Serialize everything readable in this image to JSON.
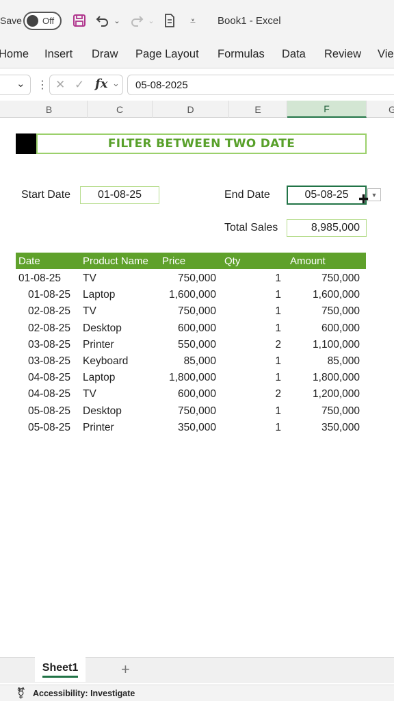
{
  "titlebar": {
    "autosave_label": "Save",
    "toggle_label": "Off",
    "book_title": "Book1  -  Excel"
  },
  "ribbon_tabs": [
    "Home",
    "Insert",
    "Draw",
    "Page Layout",
    "Formulas",
    "Data",
    "Review",
    "Vie"
  ],
  "formula_bar": {
    "fx_label": "fx",
    "value": "05-08-2025"
  },
  "columns": [
    "B",
    "C",
    "D",
    "E",
    "F",
    "G"
  ],
  "banner": {
    "title": "FILTER BETWEEN TWO DATE"
  },
  "filters": {
    "start_label": "Start Date",
    "start_value": "01-08-25",
    "end_label": "End Date",
    "end_value": "05-08-25",
    "total_label": "Total Sales",
    "total_value": "8,985,000"
  },
  "table": {
    "headers": [
      "Date",
      "Product Name",
      "Price",
      "Qty",
      "Amount"
    ],
    "rows": [
      [
        "01-08-25",
        "TV",
        "750,000",
        "1",
        "750,000"
      ],
      [
        "01-08-25",
        "Laptop",
        "1,600,000",
        "1",
        "1,600,000"
      ],
      [
        "02-08-25",
        "TV",
        "750,000",
        "1",
        "750,000"
      ],
      [
        "02-08-25",
        "Desktop",
        "600,000",
        "1",
        "600,000"
      ],
      [
        "03-08-25",
        "Printer",
        "550,000",
        "2",
        "1,100,000"
      ],
      [
        "03-08-25",
        "Keyboard",
        "85,000",
        "1",
        "85,000"
      ],
      [
        "04-08-25",
        "Laptop",
        "1,800,000",
        "1",
        "1,800,000"
      ],
      [
        "04-08-25",
        "TV",
        "600,000",
        "2",
        "1,200,000"
      ],
      [
        "05-08-25",
        "Desktop",
        "750,000",
        "1",
        "750,000"
      ],
      [
        "05-08-25",
        "Printer",
        "350,000",
        "1",
        "350,000"
      ]
    ]
  },
  "sheets": {
    "active": "Sheet1",
    "add_symbol": "+"
  },
  "status": {
    "accessibility": "Accessibility: Investigate"
  },
  "colors": {
    "header_green": "#5fa12b",
    "banner_text": "#58a02a",
    "excel_green": "#217346"
  }
}
